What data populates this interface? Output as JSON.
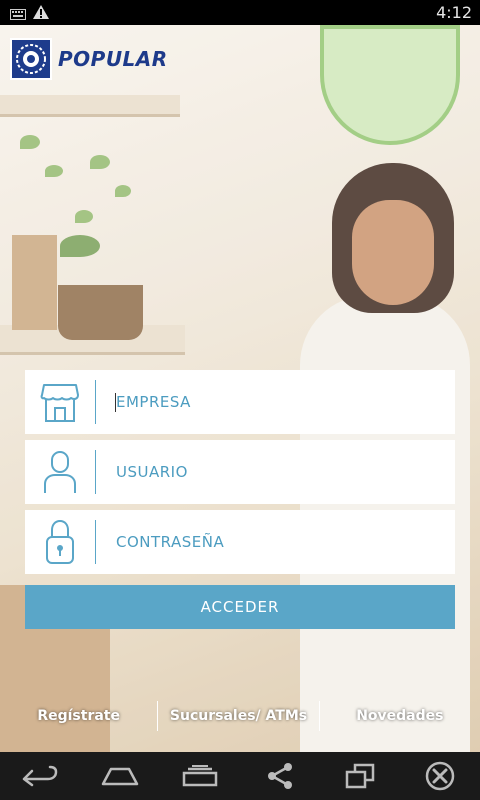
{
  "status_bar": {
    "time": "4:12",
    "icons": [
      "keyboard-icon",
      "warning-icon"
    ]
  },
  "brand": {
    "name": "POPULAR",
    "primary_color": "#1d3a8a",
    "accent_color": "#5aa6c8"
  },
  "login": {
    "empresa_placeholder": "EMPRESA",
    "usuario_placeholder": "USUARIO",
    "password_placeholder": "CONTRASEÑA",
    "submit_label": "ACCEDER",
    "icons": [
      "store-icon",
      "user-icon",
      "lock-icon"
    ]
  },
  "footer_links": {
    "register": "Regístrate",
    "branches": "Sucursales/ ATMs",
    "news": "Novedades"
  },
  "nav_bar": {
    "buttons": [
      "back-icon",
      "home-icon",
      "recent-apps-icon",
      "share-icon",
      "window-icon",
      "close-icon"
    ]
  }
}
